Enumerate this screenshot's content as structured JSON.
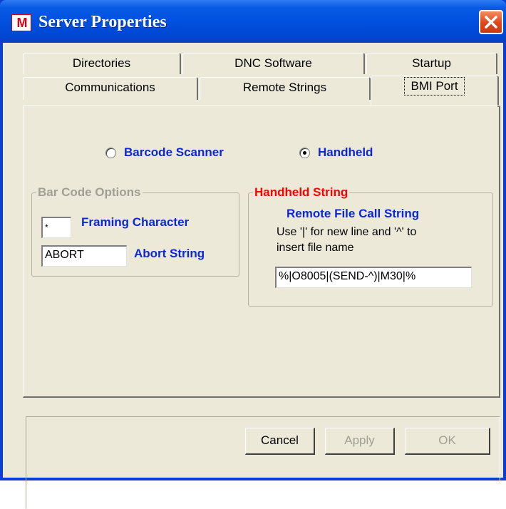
{
  "window": {
    "title": "Server Properties",
    "icon": "mx-logo-icon"
  },
  "tabs": {
    "back_row": [
      "Directories",
      "DNC Software",
      "Startup"
    ],
    "front_row": [
      "Communications",
      "Remote Strings",
      "BMI Port"
    ],
    "active": "BMI Port"
  },
  "radios": {
    "barcode": {
      "label": "Barcode Scanner",
      "selected": false
    },
    "handheld": {
      "label": "Handheld",
      "selected": true
    }
  },
  "barcode_options": {
    "title": "Bar Code Options",
    "framing_value": "*",
    "framing_label": "Framing Character",
    "abort_value": "ABORT",
    "abort_label": "Abort String"
  },
  "handheld_string": {
    "title": "Handheld String",
    "subtitle": "Remote File Call String",
    "help_line1": "Use '|' for new line and '^' to",
    "help_line2": "insert file name",
    "value": "%|O8005|(SEND-^)|M30|%"
  },
  "buttons": {
    "cancel": "Cancel",
    "apply": "Apply",
    "ok": "OK"
  },
  "colors": {
    "label_blue": "#0a28d8",
    "title_red": "#ff0000",
    "disabled_gray": "#a19f93"
  }
}
